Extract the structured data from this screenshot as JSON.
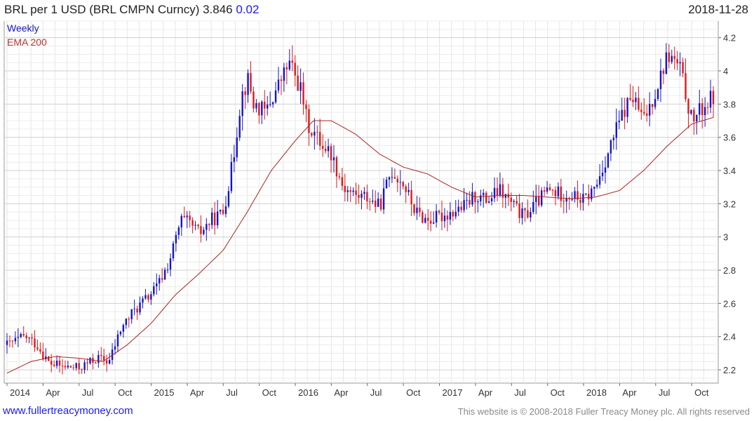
{
  "header": {
    "title": "BRL per 1 USD (BRL CMPN Curncy) 3.846",
    "change": "0.02",
    "date": "2018-11-28"
  },
  "footer": {
    "link": "www.fullertreacymoney.com",
    "copyright": "This website is © 2008-2018 Fuller Treacy Money plc. All rights reserved"
  },
  "colors": {
    "up": "#1515c8",
    "down": "#e01818",
    "ema": "#b02020",
    "grid": "#dddddd"
  },
  "chart_data": {
    "type": "candlestick",
    "legend": [
      "Weekly",
      "EMA 200"
    ],
    "legend_position": "top-left",
    "y_ticks": [
      "2.2",
      "2.4",
      "2.6",
      "2.8",
      "3",
      "3.2",
      "3.4",
      "3.6",
      "3.8",
      "4",
      "4.2"
    ],
    "ylim": [
      2.12,
      4.3
    ],
    "x_ticks": [
      "2014",
      "Apr",
      "Jul",
      "Oct",
      "2015",
      "Apr",
      "Jul",
      "Oct",
      "2016",
      "Apr",
      "Jul",
      "Oct",
      "2017",
      "Apr",
      "Jul",
      "Oct",
      "2018",
      "Apr",
      "Jul",
      "Oct"
    ],
    "x_tick_months": [
      0,
      3,
      6,
      9,
      12,
      15,
      18,
      21,
      24,
      27,
      30,
      33,
      36,
      39,
      42,
      45,
      48,
      51,
      54,
      57
    ],
    "grid": true,
    "price_anchors": [
      [
        0,
        2.35
      ],
      [
        1.5,
        2.4
      ],
      [
        2.5,
        2.35
      ],
      [
        3.5,
        2.24
      ],
      [
        4.5,
        2.22
      ],
      [
        6,
        2.21
      ],
      [
        7.5,
        2.27
      ],
      [
        8.5,
        2.25
      ],
      [
        9.5,
        2.45
      ],
      [
        10.5,
        2.55
      ],
      [
        11.5,
        2.62
      ],
      [
        12.5,
        2.7
      ],
      [
        13.5,
        2.85
      ],
      [
        14.5,
        3.1
      ],
      [
        15.2,
        3.08
      ],
      [
        16,
        3.02
      ],
      [
        17,
        3.1
      ],
      [
        18,
        3.15
      ],
      [
        18.8,
        3.45
      ],
      [
        19.5,
        3.85
      ],
      [
        20.1,
        3.95
      ],
      [
        20.5,
        3.8
      ],
      [
        21.5,
        3.75
      ],
      [
        22.5,
        3.9
      ],
      [
        23.5,
        4.05
      ],
      [
        24.5,
        3.88
      ],
      [
        25,
        3.68
      ],
      [
        26,
        3.58
      ],
      [
        27,
        3.5
      ],
      [
        28,
        3.3
      ],
      [
        29,
        3.25
      ],
      [
        30,
        3.24
      ],
      [
        31,
        3.18
      ],
      [
        32,
        3.4
      ],
      [
        33,
        3.32
      ],
      [
        34,
        3.15
      ],
      [
        35,
        3.1
      ],
      [
        36,
        3.12
      ],
      [
        37,
        3.15
      ],
      [
        38,
        3.18
      ],
      [
        39,
        3.25
      ],
      [
        40,
        3.22
      ],
      [
        41,
        3.28
      ],
      [
        42,
        3.2
      ],
      [
        43,
        3.12
      ],
      [
        44,
        3.2
      ],
      [
        45,
        3.28
      ],
      [
        46,
        3.26
      ],
      [
        47,
        3.25
      ],
      [
        48,
        3.22
      ],
      [
        49,
        3.3
      ],
      [
        50,
        3.5
      ],
      [
        51,
        3.7
      ],
      [
        52,
        3.85
      ],
      [
        53,
        3.7
      ],
      [
        54,
        3.88
      ],
      [
        55,
        4.1
      ],
      [
        56,
        4.02
      ],
      [
        57,
        3.7
      ],
      [
        58,
        3.78
      ],
      [
        58.8,
        3.846
      ]
    ],
    "ema_anchors": [
      [
        0,
        2.18
      ],
      [
        2,
        2.25
      ],
      [
        4,
        2.28
      ],
      [
        6,
        2.27
      ],
      [
        8,
        2.25
      ],
      [
        10,
        2.35
      ],
      [
        12,
        2.48
      ],
      [
        14,
        2.65
      ],
      [
        16,
        2.78
      ],
      [
        18,
        2.92
      ],
      [
        20,
        3.15
      ],
      [
        22,
        3.4
      ],
      [
        24,
        3.58
      ],
      [
        25.5,
        3.7
      ],
      [
        27,
        3.7
      ],
      [
        29,
        3.62
      ],
      [
        31,
        3.5
      ],
      [
        33,
        3.42
      ],
      [
        35,
        3.38
      ],
      [
        37,
        3.3
      ],
      [
        39,
        3.24
      ],
      [
        41,
        3.25
      ],
      [
        43,
        3.25
      ],
      [
        45,
        3.24
      ],
      [
        47,
        3.23
      ],
      [
        49,
        3.24
      ],
      [
        51,
        3.28
      ],
      [
        53,
        3.4
      ],
      [
        55,
        3.55
      ],
      [
        57,
        3.68
      ],
      [
        58.8,
        3.72
      ]
    ]
  }
}
